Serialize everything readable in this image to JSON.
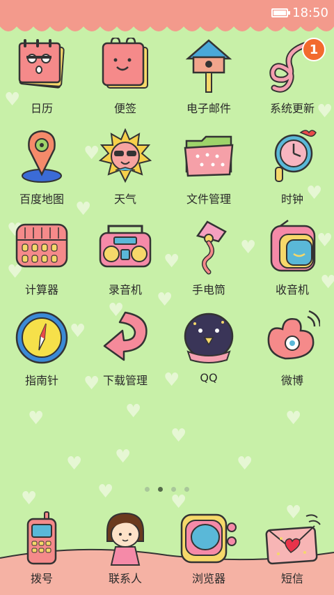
{
  "status_bar": {
    "time": "18:50",
    "battery_icon": "battery-icon"
  },
  "apps": [
    {
      "label": "日历",
      "icon": "calendar-icon"
    },
    {
      "label": "便签",
      "icon": "notepad-icon"
    },
    {
      "label": "电子邮件",
      "icon": "birdhouse-mail-icon"
    },
    {
      "label": "系统更新",
      "icon": "update-icon",
      "badge": "1"
    },
    {
      "label": "百度地图",
      "icon": "map-pin-icon"
    },
    {
      "label": "天气",
      "icon": "sun-icon"
    },
    {
      "label": "文件管理",
      "icon": "folder-icon"
    },
    {
      "label": "时钟",
      "icon": "clock-icon"
    },
    {
      "label": "计算器",
      "icon": "calculator-icon"
    },
    {
      "label": "录音机",
      "icon": "boombox-icon"
    },
    {
      "label": "手电筒",
      "icon": "lamp-icon"
    },
    {
      "label": "收音机",
      "icon": "radio-icon"
    },
    {
      "label": "指南针",
      "icon": "compass-icon"
    },
    {
      "label": "下载管理",
      "icon": "download-arrow-icon"
    },
    {
      "label": "QQ",
      "icon": "penguin-icon"
    },
    {
      "label": "微博",
      "icon": "weibo-eye-icon"
    }
  ],
  "pager": {
    "count": 4,
    "active": 1
  },
  "dock": [
    {
      "label": "拨号",
      "icon": "phone-icon"
    },
    {
      "label": "联系人",
      "icon": "girl-contact-icon"
    },
    {
      "label": "浏览器",
      "icon": "browser-tv-icon"
    },
    {
      "label": "短信",
      "icon": "envelope-heart-icon"
    }
  ],
  "colors": {
    "background": "#c8f0a8",
    "status_bar": "#f39a8c",
    "dock_ground": "#f5b2a4",
    "badge": "#f26a2e"
  }
}
